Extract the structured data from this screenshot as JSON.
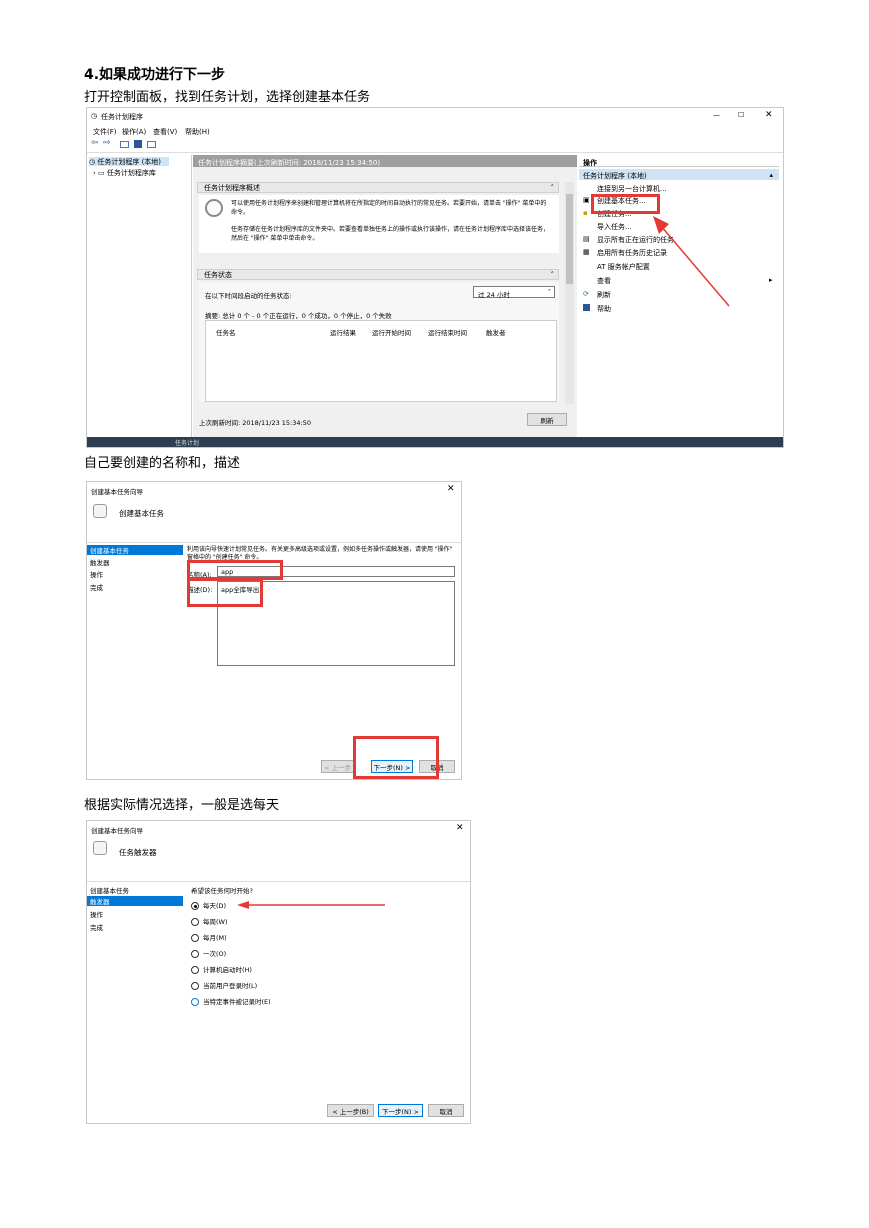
{
  "heading": "4.如果成功进行下一步",
  "step1_text": "打开控制面板，找到任务计划，选择创建基本任务",
  "step2_text": "自己要创建的名称和，描述",
  "step3_text": "根据实际情况选择，一般是选每天",
  "shot1": {
    "title": "任务计划程序",
    "menu": [
      "文件(F)",
      "操作(A)",
      "查看(V)",
      "帮助(H)"
    ],
    "tree": [
      "任务计划程序 (本地)",
      "任务计划程序库"
    ],
    "center_header": "任务计划程序摘要(上次刷新时间: 2018/11/23 15:34:50)",
    "overview_title": "任务计划程序概述",
    "overview_p1": "可以使用任务计划程序来创建和管理计算机将在所指定的时间自动执行的常见任务。若要开始，请单击 \"操作\" 菜单中的命令。",
    "overview_p2": "任务存储在任务计划程序库的文件夹中。若要查看单独任务上的操作或执行该操作，请在任务计划程序库中选择该任务，然后在 \"操作\" 菜单中单击命令。",
    "status_title": "任务状态",
    "status_label": "在以下时间段启动的任务状态:",
    "status_select": "过 24 小时",
    "summary": "摘要: 总计 0 个 - 0 个正在运行，0 个成功，0 个停止，0 个失败",
    "columns": [
      "任务名",
      "运行结果",
      "运行开始时间",
      "运行结束时间",
      "触发者"
    ],
    "last_refresh": "上次刷新时间: 2018/11/23 15:34:50",
    "refresh_btn": "刷新",
    "actions_header": "操作",
    "actions_group": "任务计划程序 (本地)",
    "actions": [
      "连接到另一台计算机...",
      "创建基本任务...",
      "创建任务...",
      "导入任务...",
      "显示所有正在运行的任务",
      "启用所有任务历史记录",
      "AT 服务帐户配置",
      "查看",
      "刷新",
      "帮助"
    ],
    "below_text": "任务计划"
  },
  "shot2": {
    "title": "创建基本任务向导",
    "header": "创建基本任务",
    "steps": [
      "创建基本任务",
      "触发器",
      "操作",
      "完成"
    ],
    "intro": "利用该向导快速计划常见任务。有关更多高级选项或设置，例如多任务操作或触发器，请使用 \"操作\" 窗格中的 \"创建任务\" 命令。",
    "name_label": "名称(A):",
    "name_value": "app",
    "desc_label": "描述(D):",
    "desc_value": "app全库导出",
    "btn_back": "< 上一步",
    "btn_next": "下一步(N) >",
    "btn_cancel": "取消"
  },
  "shot3": {
    "title": "创建基本任务向导",
    "header": "任务触发器",
    "steps": [
      "创建基本任务",
      "触发器",
      "操作",
      "完成"
    ],
    "question": "希望该任务何时开始?",
    "options": [
      "每天(D)",
      "每周(W)",
      "每月(M)",
      "一次(O)",
      "计算机启动时(H)",
      "当前用户登录时(L)",
      "当特定事件被记录时(E)"
    ],
    "btn_back": "< 上一步(B)",
    "btn_next": "下一步(N) >",
    "btn_cancel": "取消"
  },
  "colors": {
    "accent": "#0078d7",
    "annotation": "#e53935",
    "selection": "#cde6f7"
  },
  "icons": [
    "clock-icon",
    "back-arrow-icon",
    "forward-arrow-icon",
    "help-icon",
    "close-icon",
    "minimize-icon",
    "maximize-icon",
    "chevron-down-icon",
    "chevron-up-icon",
    "red-arrow-icon"
  ]
}
